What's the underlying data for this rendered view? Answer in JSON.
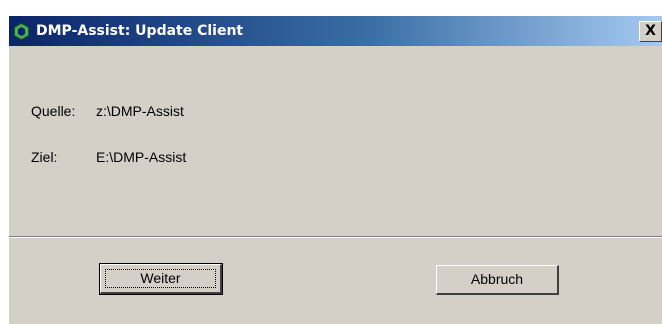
{
  "window": {
    "title": "DMP-Assist: Update Client",
    "close_label": "X"
  },
  "fields": {
    "source_label": "Quelle:",
    "source_value": "z:\\DMP-Assist",
    "target_label": "Ziel:",
    "target_value": "E:\\DMP-Assist"
  },
  "buttons": {
    "next_label": "Weiter",
    "cancel_label": "Abbruch"
  },
  "icons": {
    "app": "app-hexagon-icon"
  },
  "colors": {
    "titlebar_start": "#0a246a",
    "titlebar_end": "#a6caf0",
    "dialog_bg": "#d4d0c8",
    "app_icon_green": "#4caf50"
  }
}
